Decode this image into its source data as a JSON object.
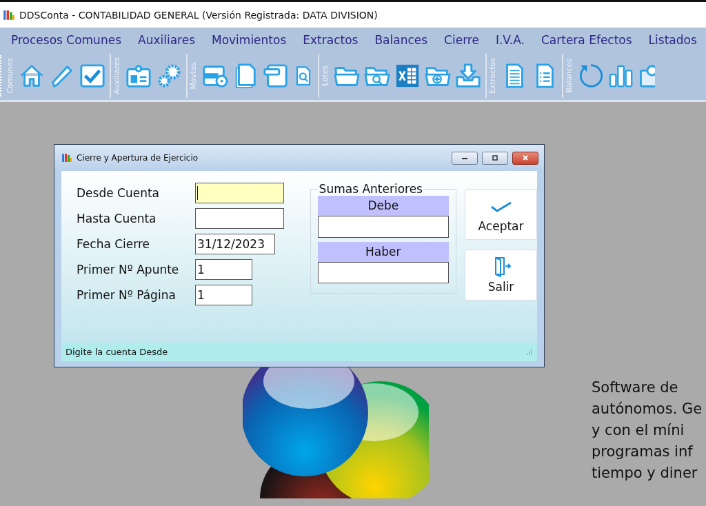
{
  "window": {
    "title": "DDSConta - CONTABILIDAD GENERAL (Versión Registrada: DATA DIVISION)"
  },
  "menu": [
    "Procesos Comunes",
    "Auxiliares",
    "Movimientos",
    "Extractos",
    "Balances",
    "Cierre",
    "I.V.A.",
    "Cartera Efectos",
    "Listados"
  ],
  "toolbar": [
    {
      "label": "Comunes"
    },
    {
      "label": "Auxiliares"
    },
    {
      "label": "Movtos"
    },
    {
      "label": "Lotes"
    },
    {
      "label": "Extractos"
    },
    {
      "label": "Balances"
    }
  ],
  "dialog": {
    "title": "Cierre y Apertura de Ejercicio",
    "fields": [
      {
        "label": "Desde Cuenta",
        "kind": "text",
        "focused": true
      },
      {
        "label": "Hasta Cuenta",
        "kind": "text",
        "focused": false
      },
      {
        "label": "Fecha Cierre",
        "value": "31/12/2023",
        "kind": "date",
        "focused": false
      },
      {
        "label": "Primer Nº Apunte",
        "value": "1",
        "kind": "number",
        "focused": false
      },
      {
        "label": "Primer Nº Página",
        "value": "1",
        "kind": "number",
        "focused": false
      }
    ],
    "sums": {
      "title": "Sumas Anteriores",
      "columns": [
        {
          "header": "Debe"
        },
        {
          "header": "Haber"
        }
      ]
    },
    "buttons": [
      {
        "label": "Aceptar",
        "kind": "accept"
      },
      {
        "label": "Salir",
        "kind": "exit"
      }
    ],
    "status": "Digite la cuenta Desde"
  },
  "description": [
    "Software de",
    "autónomos. Ge",
    "y con el míni",
    "programas inf",
    "tiempo y diner"
  ]
}
